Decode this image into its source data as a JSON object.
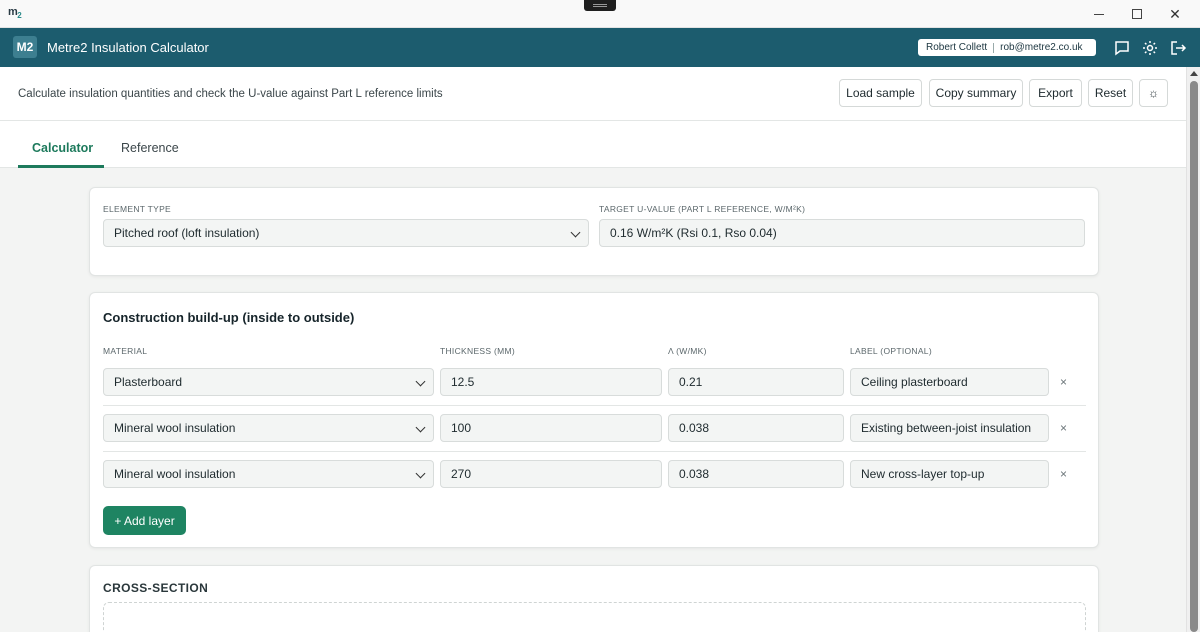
{
  "window": {
    "app_logo": "m",
    "app_logo_sub": "2",
    "minimize": "",
    "maximize": "",
    "close": "✕"
  },
  "header": {
    "logo": "M2",
    "title": "Metre2 Insulation Calculator",
    "user_name": "Robert Collett",
    "user_email": "rob@metre2.co.uk",
    "icons": [
      "chat-icon",
      "gear-icon",
      "logout-icon"
    ]
  },
  "toolbar": {
    "subtitle": "Calculate insulation quantities and check the U-value against Part L reference limits",
    "load_label": "Load sample",
    "copy_label": "Copy summary",
    "export_label": "Export",
    "reset_label": "Reset",
    "theme_icon": "☼"
  },
  "tabs": [
    {
      "label": "Calculator",
      "active": true
    },
    {
      "label": "Reference",
      "active": false
    }
  ],
  "element": {
    "type_label": "ELEMENT TYPE",
    "type_value": "Pitched roof (loft insulation)",
    "target_label": "TARGET U-VALUE (PART L REFERENCE, W/M²K)",
    "target_value": "0.16 W/m²K (Rsi 0.1, Rso 0.04)"
  },
  "layers": {
    "title": "Construction build-up (inside to outside)",
    "columns": [
      "MATERIAL",
      "THICKNESS (MM)",
      "Λ (W/MK)",
      "LABEL (OPTIONAL)"
    ],
    "rows": [
      {
        "material": "Plasterboard",
        "thickness": "12.5",
        "lambda": "0.21",
        "label": "Ceiling plasterboard",
        "remove": "×"
      },
      {
        "material": "Mineral wool insulation",
        "thickness": "100",
        "lambda": "0.038",
        "label": "Existing between-joist insulation",
        "remove": "×"
      },
      {
        "material": "Mineral wool insulation",
        "thickness": "270",
        "lambda": "0.038",
        "label": "New cross-layer top-up",
        "remove": "×"
      }
    ],
    "add_label": "+ Add layer"
  },
  "cross_section": {
    "title": "CROSS-SECTION"
  },
  "colors": {
    "header": "#1c5c6e",
    "accent": "#1d7a5c",
    "button": "#1e8462"
  }
}
